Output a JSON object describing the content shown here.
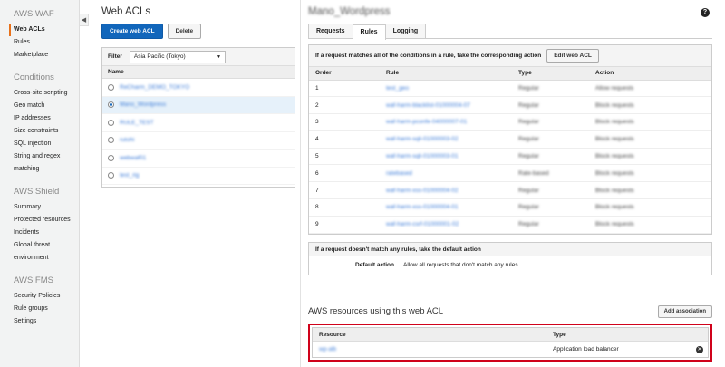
{
  "sidebar": {
    "sections": [
      {
        "title": "AWS WAF",
        "items": [
          "Web ACLs",
          "Rules",
          "Marketplace"
        ]
      },
      {
        "title": "Conditions",
        "items": [
          "Cross-site scripting",
          "Geo match",
          "IP addresses",
          "Size constraints",
          "SQL injection",
          "String and regex matching"
        ]
      },
      {
        "title": "AWS Shield",
        "items": [
          "Summary",
          "Protected resources",
          "Incidents",
          "Global threat environment"
        ]
      },
      {
        "title": "AWS FMS",
        "items": [
          "Security Policies",
          "Rule groups",
          "Settings"
        ]
      }
    ],
    "collapse_glyph": "◀"
  },
  "acl_pane": {
    "title": "Web ACLs",
    "create_label": "Create web ACL",
    "delete_label": "Delete",
    "filter_label": "Filter",
    "region_value": "Asia Pacific (Tokyo)",
    "dropdown_glyph": "▼",
    "name_header": "Name",
    "items": [
      {
        "name": "ReCharm_DEMO_TOKYO",
        "selected": false
      },
      {
        "name": "Mano_Wordpress",
        "selected": true
      },
      {
        "name": "RULE_TEST",
        "selected": false
      },
      {
        "name": "rutohi",
        "selected": false
      },
      {
        "name": "webwaf01",
        "selected": false
      },
      {
        "name": "test_rig",
        "selected": false
      }
    ]
  },
  "detail": {
    "title": "Mano_Wordpress",
    "help_glyph": "?",
    "tabs": [
      "Requests",
      "Rules",
      "Logging"
    ],
    "active_tab": "Rules",
    "rules_hint": "If a request matches all of the conditions in a rule, take the corresponding action",
    "edit_label": "Edit web ACL",
    "headers": [
      "Order",
      "Rule",
      "Type",
      "Action"
    ],
    "rows": [
      {
        "order": "1",
        "rule": "test_geo",
        "type": "Regular",
        "action": "Allow requests"
      },
      {
        "order": "2",
        "rule": "waf-harm-blacklist-01000004-07",
        "type": "Regular",
        "action": "Block requests"
      },
      {
        "order": "3",
        "rule": "waf-harm-pconfe-04000007-01",
        "type": "Regular",
        "action": "Block requests"
      },
      {
        "order": "4",
        "rule": "waf-harm-sqli-01000003-02",
        "type": "Regular",
        "action": "Block requests"
      },
      {
        "order": "5",
        "rule": "waf-harm-sqli-01000003-01",
        "type": "Regular",
        "action": "Block requests"
      },
      {
        "order": "6",
        "rule": "ratebased",
        "type": "Rate-based",
        "action": "Block requests"
      },
      {
        "order": "7",
        "rule": "waf-harm-xss-01000004-02",
        "type": "Regular",
        "action": "Block requests"
      },
      {
        "order": "8",
        "rule": "waf-harm-xss-01000004-01",
        "type": "Regular",
        "action": "Block requests"
      },
      {
        "order": "9",
        "rule": "waf-harm-csrf-01000001-02",
        "type": "Regular",
        "action": "Block requests"
      }
    ],
    "default_hint": "If a request doesn't match any rules, take the default action",
    "default_action_label": "Default action",
    "default_action_value": "Allow all requests that don't match any rules",
    "resources_title": "AWS resources using this web ACL",
    "add_assoc_label": "Add association",
    "resource_header": "Resource",
    "type_header": "Type",
    "resource_name": "wp-alb",
    "resource_type": "Application load balancer",
    "remove_glyph": "✕"
  }
}
